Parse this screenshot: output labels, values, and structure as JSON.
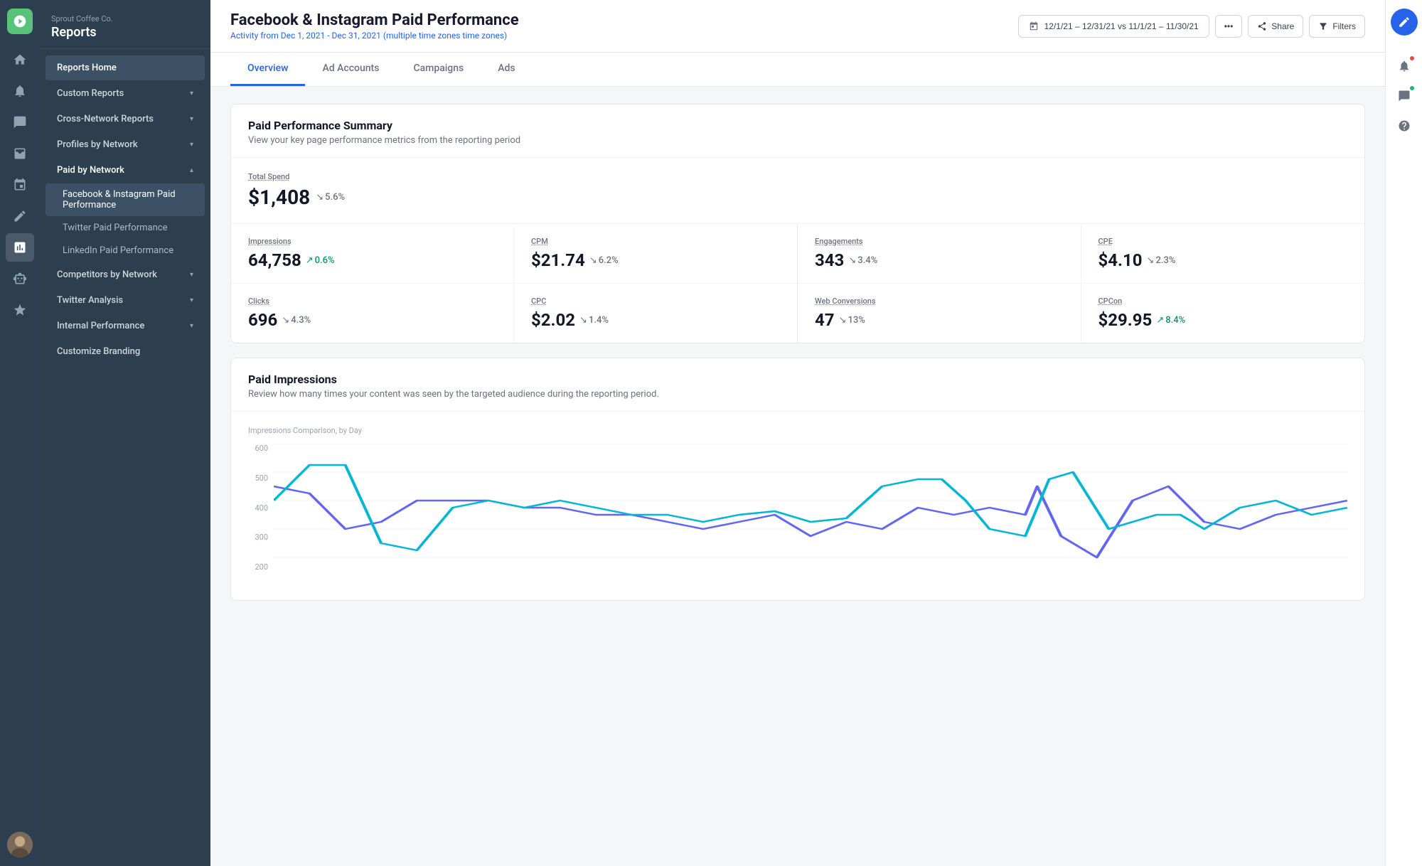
{
  "company": "Sprout Coffee Co.",
  "app_title": "Reports",
  "sidebar": {
    "items": [
      {
        "id": "reports-home",
        "label": "Reports Home",
        "active": true,
        "sub": []
      },
      {
        "id": "custom-reports",
        "label": "Custom Reports",
        "expanded": false,
        "sub": []
      },
      {
        "id": "cross-network",
        "label": "Cross-Network Reports",
        "expanded": false,
        "sub": []
      },
      {
        "id": "profiles-by-network",
        "label": "Profiles by Network",
        "expanded": false,
        "sub": []
      },
      {
        "id": "paid-by-network",
        "label": "Paid by Network",
        "expanded": true,
        "sub": [
          {
            "id": "fb-ig-paid",
            "label": "Facebook & Instagram Paid Performance",
            "active": true
          },
          {
            "id": "twitter-paid",
            "label": "Twitter Paid Performance",
            "active": false
          },
          {
            "id": "linkedin-paid",
            "label": "LinkedIn Paid Performance",
            "active": false
          }
        ]
      },
      {
        "id": "competitors-by-network",
        "label": "Competitors by Network",
        "expanded": false,
        "sub": []
      },
      {
        "id": "twitter-analysis",
        "label": "Twitter Analysis",
        "expanded": false,
        "sub": []
      },
      {
        "id": "internal-performance",
        "label": "Internal Performance",
        "expanded": false,
        "sub": []
      },
      {
        "id": "customize-branding",
        "label": "Customize Branding",
        "sub": []
      }
    ]
  },
  "header": {
    "title": "Facebook & Instagram Paid Performance",
    "subtitle": "Activity from Dec 1, 2021 - Dec 31, 2021",
    "timezone": "multiple time zones",
    "date_range": "12/1/21 – 12/31/21",
    "compare_range": "vs 11/1/21 – 11/30/21"
  },
  "tabs": [
    {
      "id": "overview",
      "label": "Overview",
      "active": true
    },
    {
      "id": "ad-accounts",
      "label": "Ad Accounts",
      "active": false
    },
    {
      "id": "campaigns",
      "label": "Campaigns",
      "active": false
    },
    {
      "id": "ads",
      "label": "Ads",
      "active": false
    }
  ],
  "summary_card": {
    "title": "Paid Performance Summary",
    "subtitle": "View your key page performance metrics from the reporting period",
    "total_spend_label": "Total Spend",
    "total_spend_value": "$1,408",
    "total_spend_change": "5.6%",
    "total_spend_direction": "down",
    "metrics_left": [
      {
        "label": "Impressions",
        "value": "64,758",
        "change": "0.6%",
        "direction": "up"
      },
      {
        "label": "CPM",
        "value": "$21.74",
        "change": "6.2%",
        "direction": "down"
      },
      {
        "label": "Clicks",
        "value": "696",
        "change": "4.3%",
        "direction": "down"
      },
      {
        "label": "CPC",
        "value": "$2.02",
        "change": "1.4%",
        "direction": "down"
      }
    ],
    "metrics_right": [
      {
        "label": "Engagements",
        "value": "343",
        "change": "3.4%",
        "direction": "down"
      },
      {
        "label": "CPE",
        "value": "$4.10",
        "change": "2.3%",
        "direction": "down"
      },
      {
        "label": "Web Conversions",
        "value": "47",
        "change": "13%",
        "direction": "down"
      },
      {
        "label": "CPCon",
        "value": "$29.95",
        "change": "8.4%",
        "direction": "up"
      }
    ]
  },
  "impressions_card": {
    "title": "Paid Impressions",
    "subtitle": "Review how many times your content was seen by the targeted audience during the reporting period.",
    "chart_label": "Impressions Comparison, by Day",
    "y_axis": [
      "600",
      "500",
      "400",
      "300",
      "200"
    ],
    "colors": {
      "line1": "#6366f1",
      "line2": "#06b6d4"
    }
  },
  "buttons": {
    "share": "Share",
    "filters": "Filters",
    "more": "..."
  }
}
